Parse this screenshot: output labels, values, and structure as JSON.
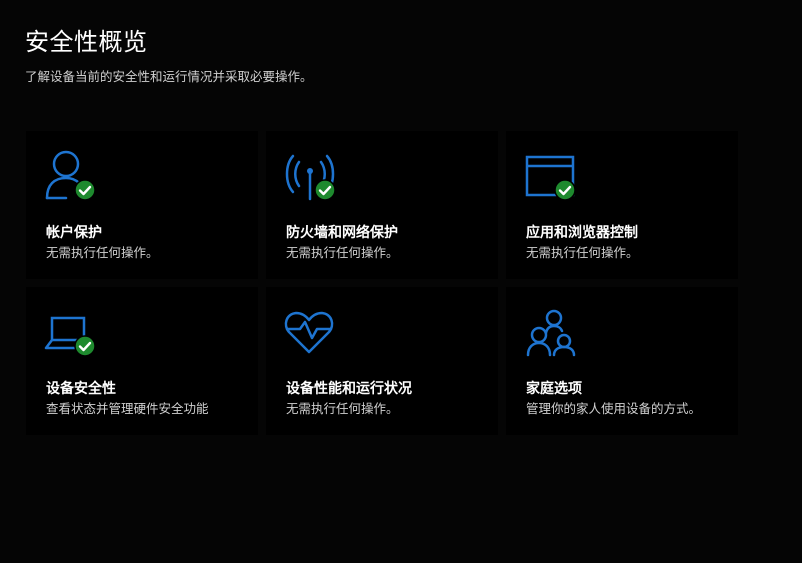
{
  "header": {
    "title": "安全性概览",
    "subtitle": "了解设备当前的安全性和运行情况并采取必要操作。"
  },
  "colors": {
    "accent": "#1e74d0",
    "ok": "#1e8a2e",
    "background": "#050505",
    "tile": "#000000"
  },
  "tiles": [
    {
      "title": "帐户保护",
      "desc": "无需执行任何操作。",
      "icon": "account-icon",
      "status": "ok"
    },
    {
      "title": "防火墙和网络保护",
      "desc": "无需执行任何操作。",
      "icon": "firewall-network-icon",
      "status": "ok"
    },
    {
      "title": "应用和浏览器控制",
      "desc": "无需执行任何操作。",
      "icon": "app-browser-icon",
      "status": "ok"
    },
    {
      "title": "设备安全性",
      "desc": "查看状态并管理硬件安全功能",
      "icon": "laptop-icon",
      "status": "ok"
    },
    {
      "title": "设备性能和运行状况",
      "desc": "无需执行任何操作。",
      "icon": "heart-pulse-icon",
      "status": "none"
    },
    {
      "title": "家庭选项",
      "desc": "管理你的家人使用设备的方式。",
      "icon": "family-icon",
      "status": "none"
    }
  ]
}
